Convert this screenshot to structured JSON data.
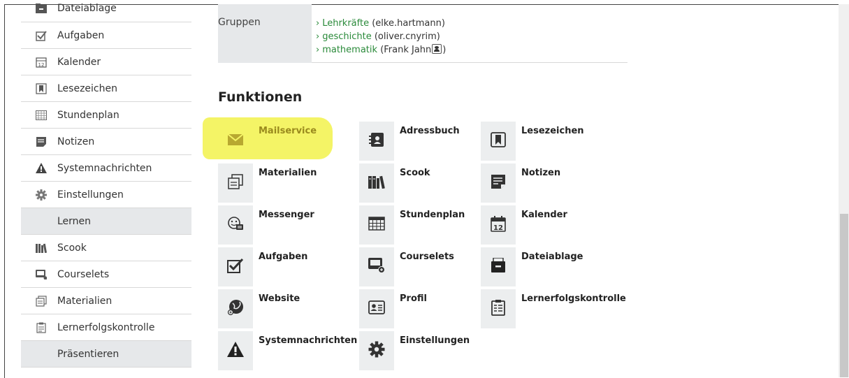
{
  "sidebar": {
    "items": [
      {
        "label": "Dateiablage",
        "icon": "folder-icon"
      },
      {
        "label": "Aufgaben",
        "icon": "checkbox-icon"
      },
      {
        "label": "Kalender",
        "icon": "calendar-icon"
      },
      {
        "label": "Lesezeichen",
        "icon": "bookmark-icon"
      },
      {
        "label": "Stundenplan",
        "icon": "timetable-icon"
      },
      {
        "label": "Notizen",
        "icon": "note-icon"
      },
      {
        "label": "Systemnachrichten",
        "icon": "warning-icon"
      },
      {
        "label": "Einstellungen",
        "icon": "gear-icon"
      },
      {
        "label": "Lernen",
        "section": true
      },
      {
        "label": "Scook",
        "icon": "books-icon"
      },
      {
        "label": "Courselets",
        "icon": "courselet-icon"
      },
      {
        "label": "Materialien",
        "icon": "materials-icon"
      },
      {
        "label": "Lernerfolgskontrolle",
        "icon": "clipboard-icon"
      },
      {
        "label": "Präsentieren",
        "section": true
      }
    ]
  },
  "groups": {
    "label": "Gruppen",
    "entries": [
      {
        "name": "Lehrkräfte",
        "owner": "(elke.hartmann)"
      },
      {
        "name": "geschichte",
        "owner": "(oliver.cnyrim)"
      },
      {
        "name": "mathematik",
        "owner_pre": "(Frank Jahn",
        "owner_post": ")"
      }
    ]
  },
  "functions": {
    "title": "Funktionen",
    "items": [
      {
        "label": "Mailservice",
        "icon": "mail-icon"
      },
      {
        "label": "Adressbuch",
        "icon": "address-book-icon"
      },
      {
        "label": "Lesezeichen",
        "icon": "bookmark-icon"
      },
      {
        "label": "Materialien",
        "icon": "materials-icon"
      },
      {
        "label": "Scook",
        "icon": "books-icon"
      },
      {
        "label": "Notizen",
        "icon": "note-icon"
      },
      {
        "label": "Messenger",
        "icon": "messenger-icon"
      },
      {
        "label": "Stundenplan",
        "icon": "timetable-icon"
      },
      {
        "label": "Kalender",
        "icon": "calendar-icon"
      },
      {
        "label": "Aufgaben",
        "icon": "checkbox-icon"
      },
      {
        "label": "Courselets",
        "icon": "courselet-icon"
      },
      {
        "label": "Dateiablage",
        "icon": "folder-icon"
      },
      {
        "label": "Website",
        "icon": "globe-icon"
      },
      {
        "label": "Profil",
        "icon": "profile-card-icon"
      },
      {
        "label": "Lernerfolgskontrolle",
        "icon": "clipboard-icon"
      },
      {
        "label": "Systemnachrichten",
        "icon": "warning-icon"
      },
      {
        "label": "Einstellungen",
        "icon": "gear-icon"
      }
    ]
  },
  "colors": {
    "highlight": "#f4f466",
    "link_green": "#2a8a3a",
    "panel_grey": "#e6e8ea"
  }
}
